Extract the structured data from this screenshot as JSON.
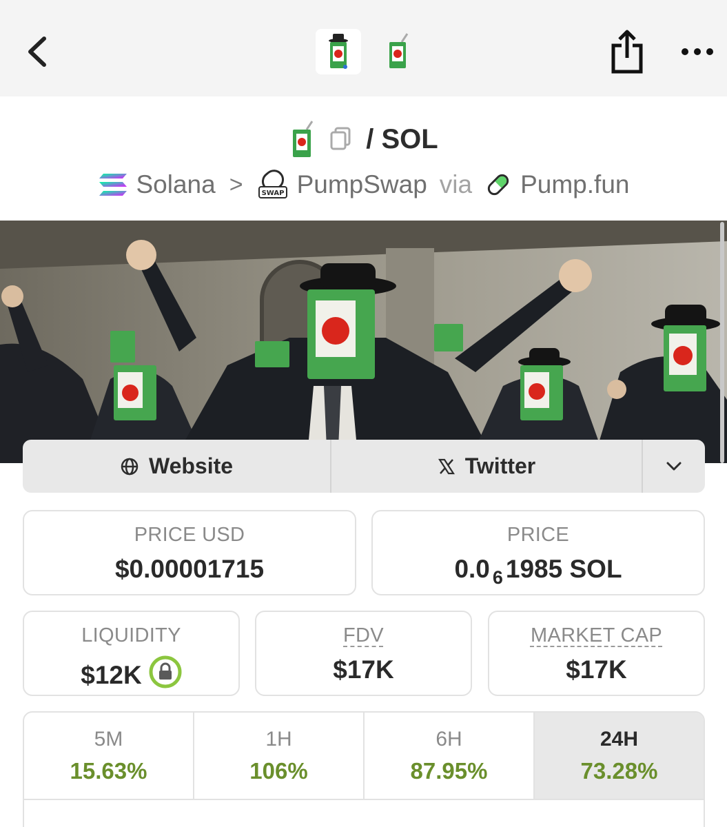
{
  "pair": {
    "quote": "/ SOL"
  },
  "chain": {
    "name": "Solana",
    "separator": ">",
    "dex": "PumpSwap",
    "via": "via",
    "launchpad": "Pump.fun"
  },
  "socials": {
    "website": "Website",
    "twitter": "Twitter"
  },
  "stats": {
    "price_usd": {
      "label": "PRICE USD",
      "value": "$0.00001715"
    },
    "price": {
      "label": "PRICE",
      "prefix": "0.0",
      "zeros": "6",
      "suffix": "1985 SOL"
    },
    "liquidity": {
      "label": "LIQUIDITY",
      "value": "$12K"
    },
    "fdv": {
      "label": "FDV",
      "value": "$17K"
    },
    "market_cap": {
      "label": "MARKET CAP",
      "value": "$17K"
    }
  },
  "timeframes": [
    {
      "label": "5M",
      "value": "15.63%"
    },
    {
      "label": "1H",
      "value": "106%"
    },
    {
      "label": "6H",
      "value": "87.95%"
    },
    {
      "label": "24H",
      "value": "73.28%"
    }
  ],
  "colors": {
    "positive": "#6a8f2c",
    "green_box": "#3aa24a",
    "apple": "#d9261c"
  },
  "icons": {
    "back": "chevron-left-icon",
    "share": "share-icon",
    "more": "more-dots-icon",
    "token": "juice-box-icon",
    "copy": "copy-icon",
    "solana": "solana-logo-icon",
    "pumpswap": "pumpswap-logo-icon",
    "pumpfun": "pill-icon",
    "globe": "globe-icon",
    "x": "x-logo-icon",
    "chevron_down": "chevron-down-icon",
    "lock": "lock-icon"
  }
}
